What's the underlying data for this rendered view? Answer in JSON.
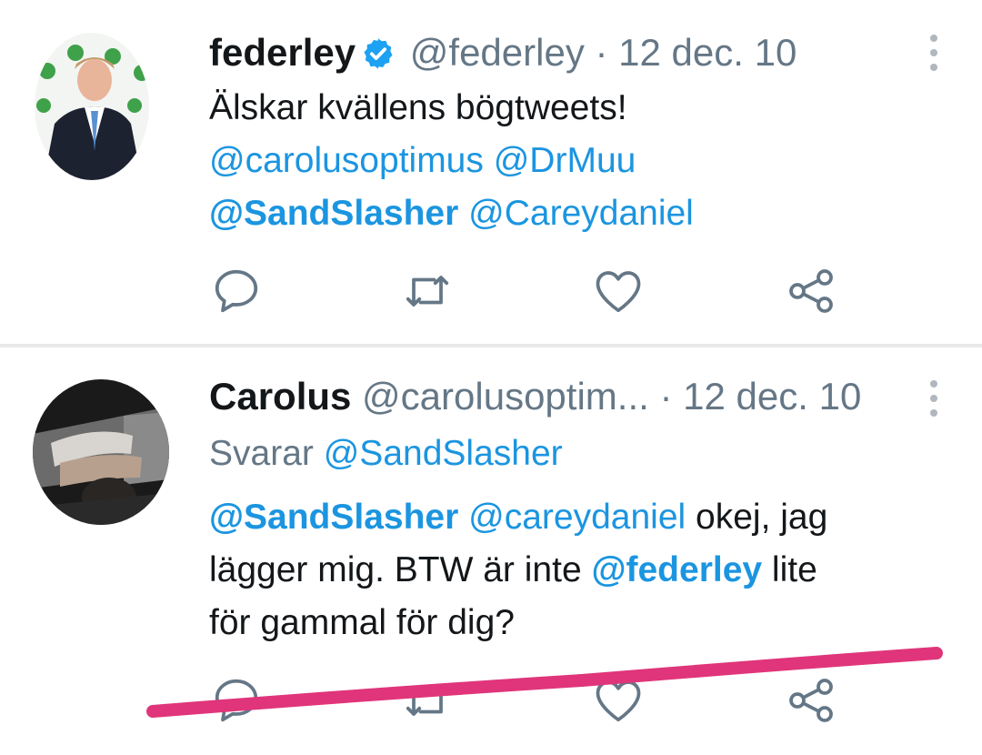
{
  "tweets": [
    {
      "name": "federley",
      "handle": "@federley",
      "separator": "·",
      "date": "12 dec. 10",
      "text_line1": "Älskar kvällens bögtweets!",
      "mentions_line2": [
        "@carolusoptimus",
        "@DrMuu"
      ],
      "mentions_line3": [
        "@SandSlasher",
        "@Careydaniel"
      ]
    },
    {
      "name": "Carolus",
      "handle": "@carolusoptim...",
      "separator": "·",
      "date": "12 dec. 10",
      "reply_prefix": "Svarar",
      "reply_to": "@SandSlasher",
      "line1_mention_a": "@SandSlasher",
      "line1_mention_b": "@careydaniel",
      "line1_text": " okej, jag",
      "line2_text": "lägger mig. BTW är inte ",
      "line2_mention": "@federley",
      "line2_tail": " lite",
      "line3_text": "för gammal för dig?"
    }
  ],
  "icons": [
    "reply-icon",
    "retweet-icon",
    "like-icon",
    "share-icon",
    "more-options-icon",
    "verified-badge-icon"
  ],
  "colors": {
    "name": "#14171a",
    "secondary": "#657786",
    "link": "#1b95e0",
    "verified": "#1da1f2",
    "icon": "#657786",
    "annotation": "#e0357a"
  }
}
